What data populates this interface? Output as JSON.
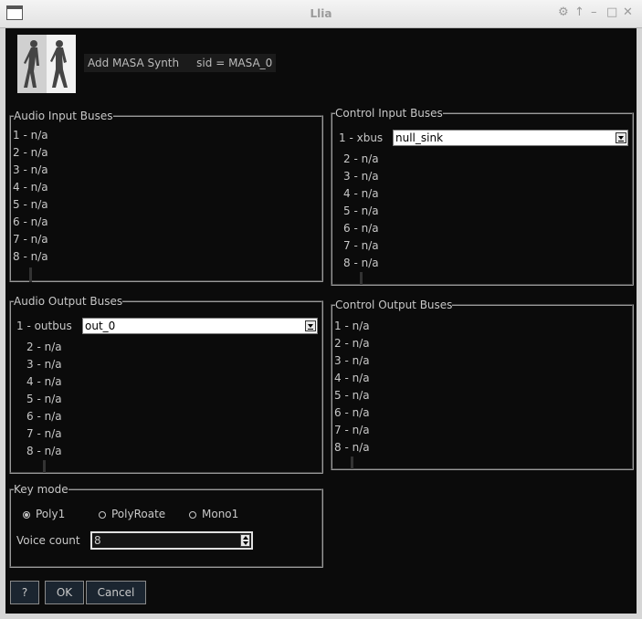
{
  "window": {
    "title": "Llia"
  },
  "header": {
    "text": "Add MASA Synth     sid = MASA_0"
  },
  "audio_input": {
    "legend": "Audio Input Buses",
    "items": [
      "1 - n/a",
      "2 - n/a",
      "3 - n/a",
      "4 - n/a",
      "5 - n/a",
      "6 - n/a",
      "7 - n/a",
      "8 - n/a"
    ]
  },
  "control_input": {
    "legend": "Control Input Buses",
    "first_label": "1 - xbus",
    "first_value": "null_sink",
    "items": [
      "2 - n/a",
      "3 - n/a",
      "4 - n/a",
      "5 - n/a",
      "6 - n/a",
      "7 - n/a",
      "8 - n/a"
    ]
  },
  "audio_output": {
    "legend": "Audio Output Buses",
    "first_label": "1 - outbus",
    "first_value": "out_0",
    "items": [
      "2 - n/a",
      "3 - n/a",
      "4 - n/a",
      "5 - n/a",
      "6 - n/a",
      "7 - n/a",
      "8 - n/a"
    ]
  },
  "control_output": {
    "legend": "Control Output Buses",
    "items": [
      "1 - n/a",
      "2 - n/a",
      "3 - n/a",
      "4 - n/a",
      "5 - n/a",
      "6 - n/a",
      "7 - n/a",
      "8 - n/a"
    ]
  },
  "key_mode": {
    "legend": "Key mode",
    "options": [
      "Poly1",
      "PolyRoate",
      "Mono1"
    ],
    "selected": "Poly1",
    "voice_label": "Voice count",
    "voice_value": "8"
  },
  "buttons": {
    "help": "?",
    "ok": "OK",
    "cancel": "Cancel"
  }
}
